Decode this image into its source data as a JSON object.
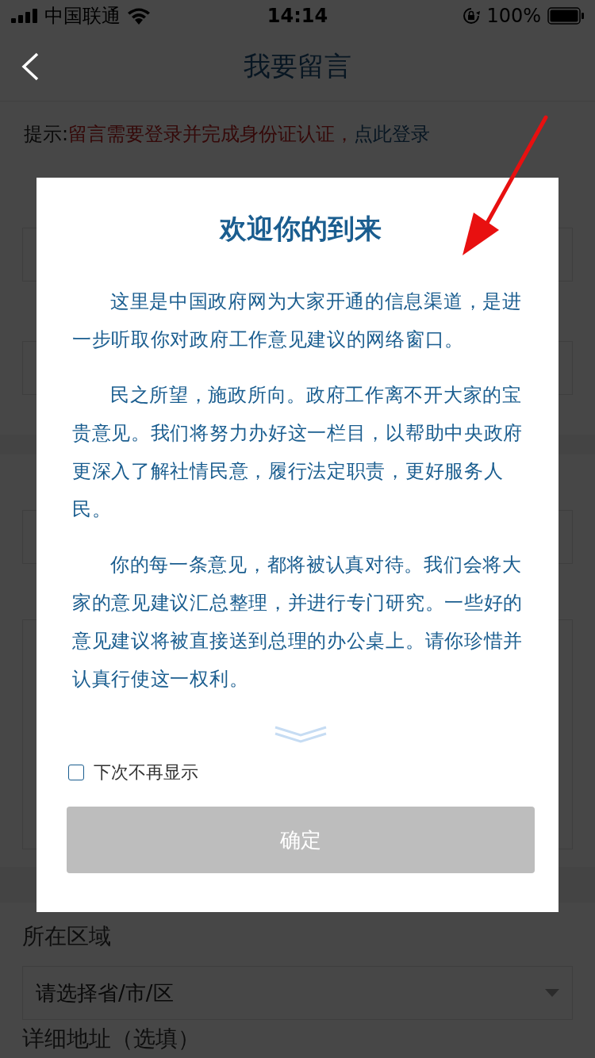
{
  "status_bar": {
    "carrier": "中国联通",
    "time": "14:14",
    "battery": "100%"
  },
  "nav": {
    "title": "我要留言"
  },
  "hint": {
    "prefix": "提示:",
    "message": "留言需要登录并完成身份证认证，",
    "link": "点此登录"
  },
  "sections": [
    {
      "fields": [
        {
          "kind": "input"
        },
        {
          "kind": "input"
        }
      ]
    },
    {
      "fields": [
        {
          "kind": "input"
        },
        {
          "kind": "textarea"
        }
      ]
    },
    {
      "fields": [
        {
          "label": "所在区域",
          "kind": "select",
          "placeholder": "请选择省/市/区"
        },
        {
          "label": "详细地址（选填）",
          "kind": "label"
        }
      ]
    }
  ],
  "dialog": {
    "title": "欢迎你的到来",
    "paragraphs": [
      "这里是中国政府网为大家开通的信息渠道，是进一步听取你对政府工作意见建议的网络窗口。",
      "民之所望，施政所向。政府工作离不开大家的宝贵意见。我们将努力办好这一栏目，以帮助中央政府更深入了解社情民意，履行法定职责，更好服务人民。",
      "你的每一条意见，都将被认真对待。我们会将大家的意见建议汇总整理，并进行专门研究。一些好的意见建议将被直接送到总理的办公桌上。请你珍惜并认真行使这一权利。"
    ],
    "dont_show": {
      "label": "下次不再显示",
      "checked": false
    },
    "confirm": {
      "label": "确定",
      "disabled": true
    }
  }
}
